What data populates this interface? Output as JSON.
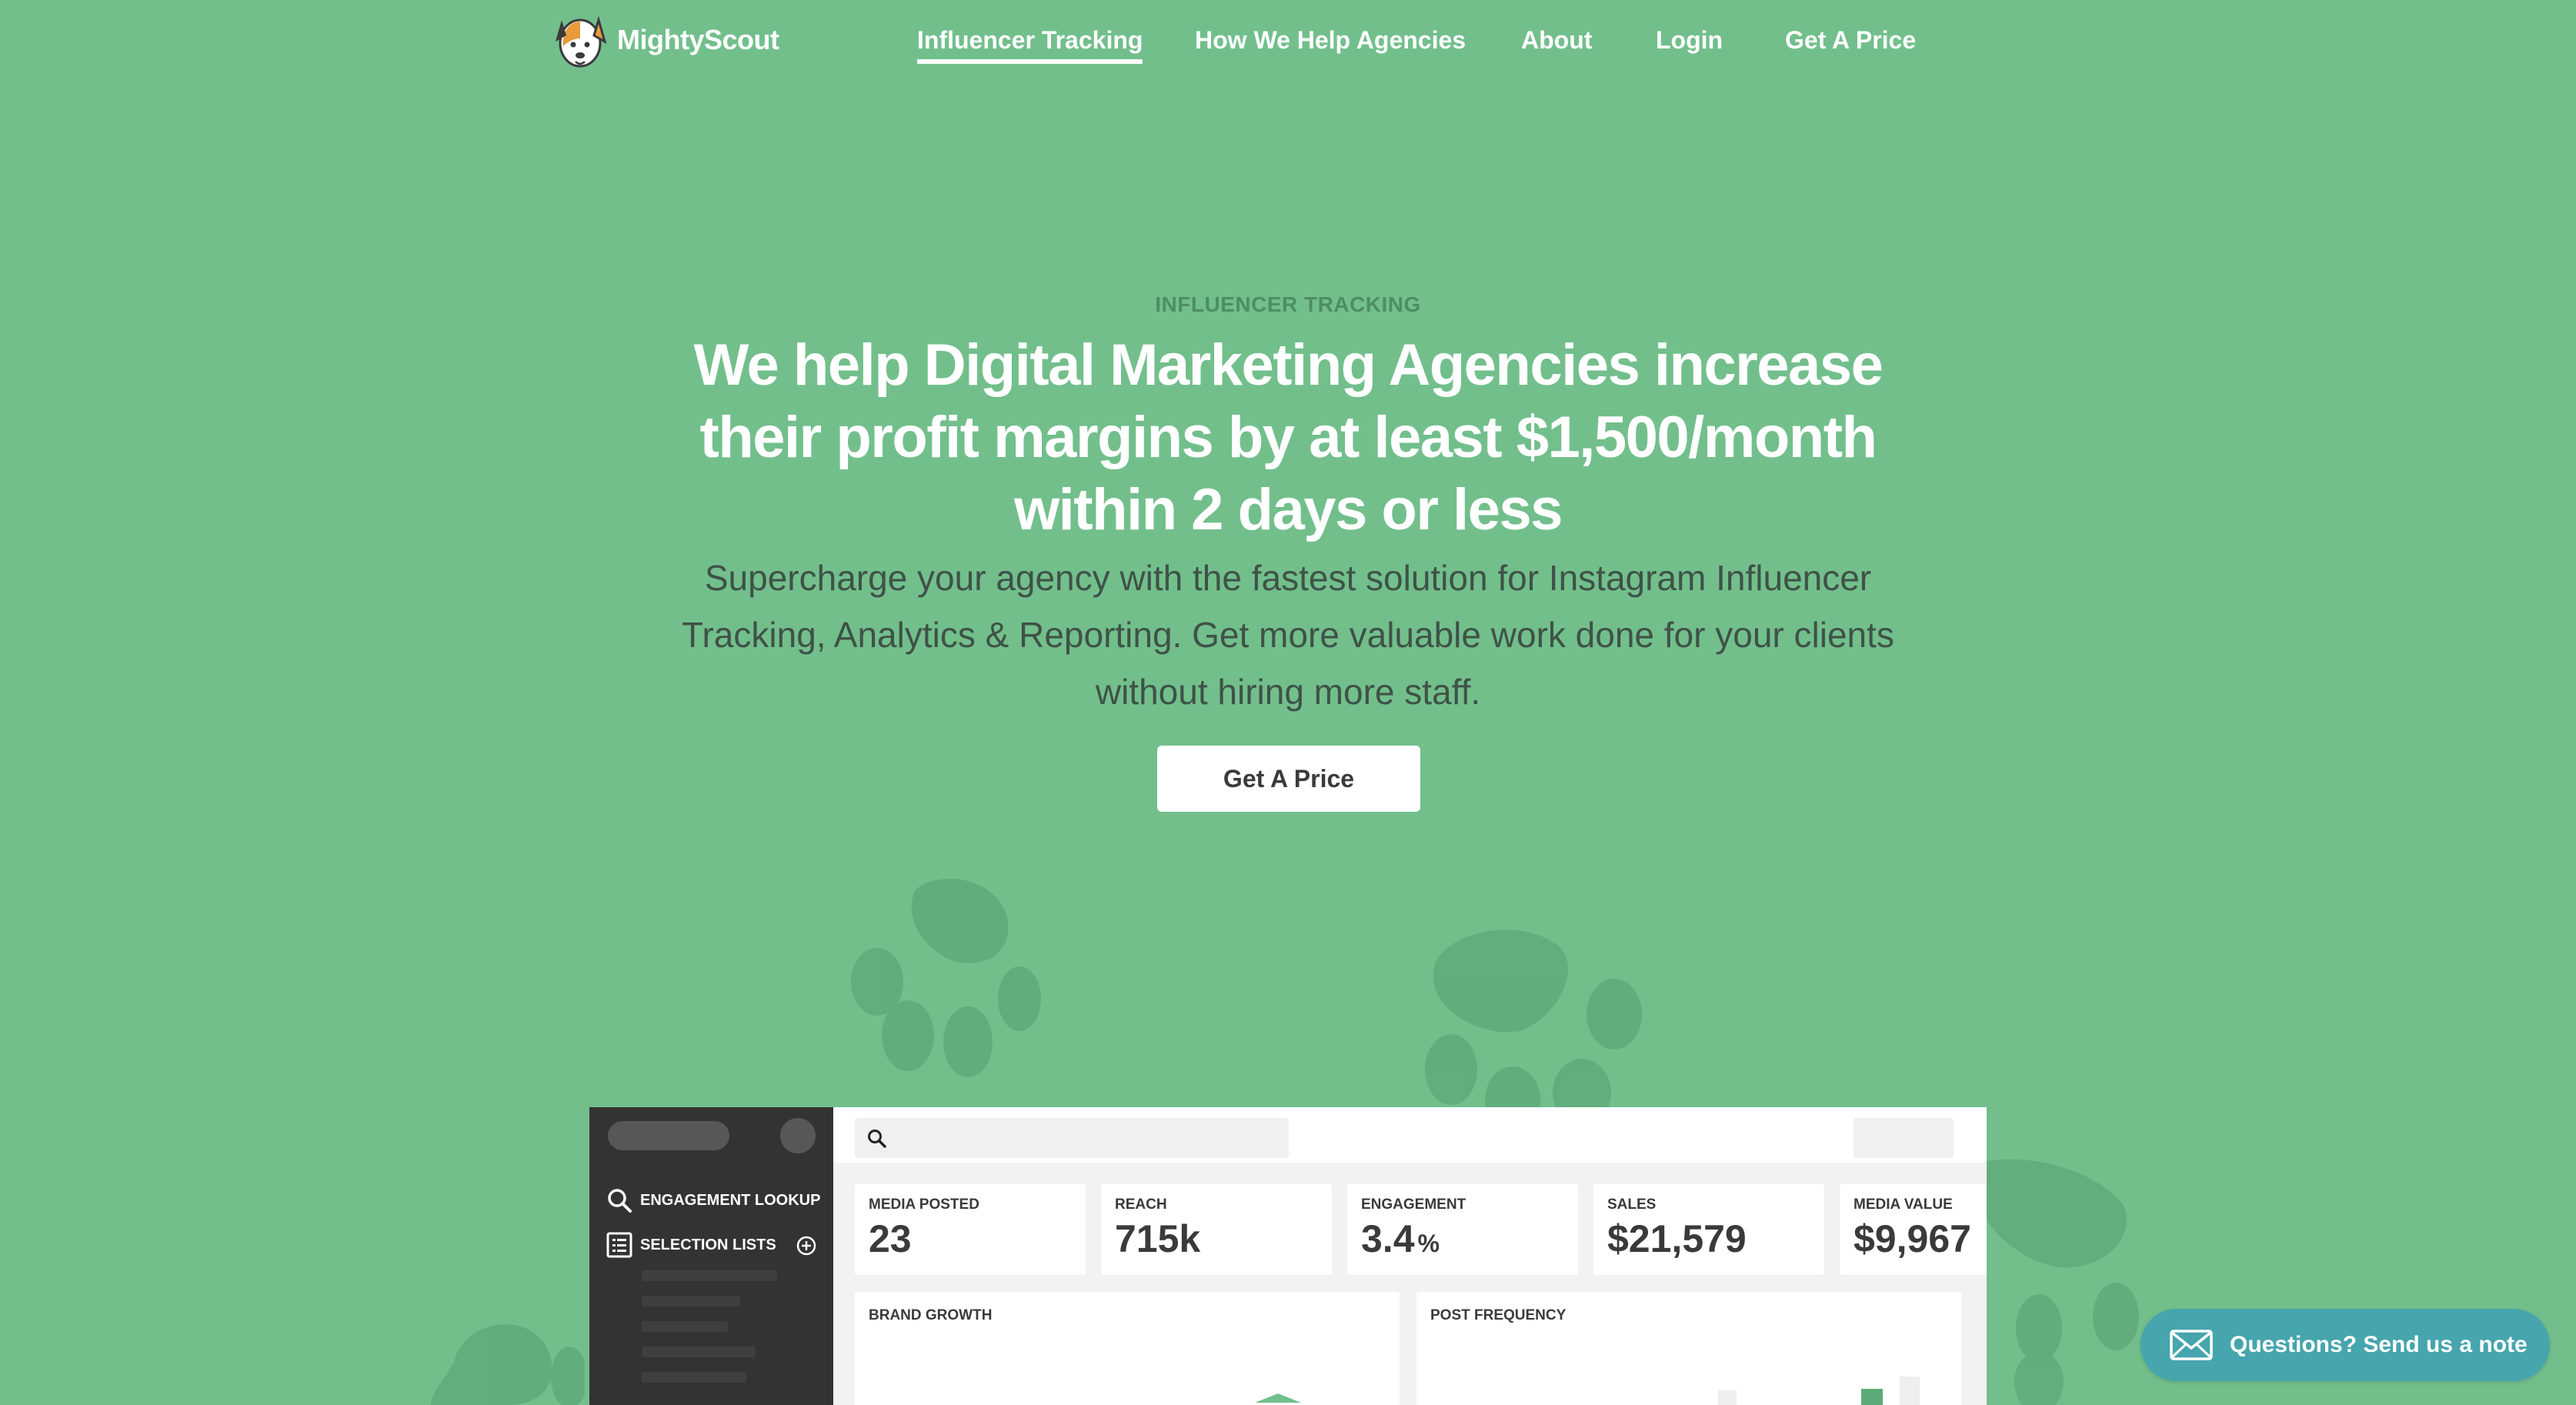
{
  "brand": {
    "name": "MightyScout",
    "logo_icon": "dog-face-icon"
  },
  "nav": {
    "items": [
      {
        "label": "Influencer Tracking",
        "active": true
      },
      {
        "label": "How We Help Agencies",
        "active": false
      },
      {
        "label": "About",
        "active": false
      },
      {
        "label": "Login",
        "active": false
      },
      {
        "label": "Get A Price",
        "active": false
      }
    ]
  },
  "hero": {
    "eyebrow": "INFLUENCER TRACKING",
    "headline": "We help Digital Marketing Agencies increase their profit margins by at least $1,500/month within 2 days or less",
    "subhead": "Supercharge your agency with the fastest solution for Instagram Influencer Tracking, Analytics & Reporting. Get more valuable work done for your clients without hiring more staff.",
    "cta_label": "Get A Price"
  },
  "dashboard": {
    "sidebar": {
      "items": [
        {
          "label": "ENGAGEMENT LOOKUP",
          "icon": "search-icon"
        },
        {
          "label": "SELECTION LISTS",
          "icon": "list-icon"
        }
      ],
      "add_icon": "plus-circle-icon"
    },
    "stats": [
      {
        "label": "MEDIA POSTED",
        "value": "23",
        "unit": ""
      },
      {
        "label": "REACH",
        "value": "715k",
        "unit": ""
      },
      {
        "label": "ENGAGEMENT",
        "value": "3.4",
        "unit": "%"
      },
      {
        "label": "SALES",
        "value": "$21,579",
        "unit": ""
      },
      {
        "label": "MEDIA VALUE",
        "value": "$9,967",
        "unit": ""
      }
    ],
    "panels": [
      {
        "label": "BRAND GROWTH"
      },
      {
        "label": "POST FREQUENCY"
      }
    ]
  },
  "chat": {
    "label": "Questions? Send us a note",
    "icon": "envelope-icon"
  },
  "colors": {
    "background": "#72bf8c",
    "paw": "#5fa878",
    "eyebrow": "#4e8e63",
    "subhead": "#3f5247",
    "chat": "#46a5ad",
    "sidebar": "#333333"
  }
}
